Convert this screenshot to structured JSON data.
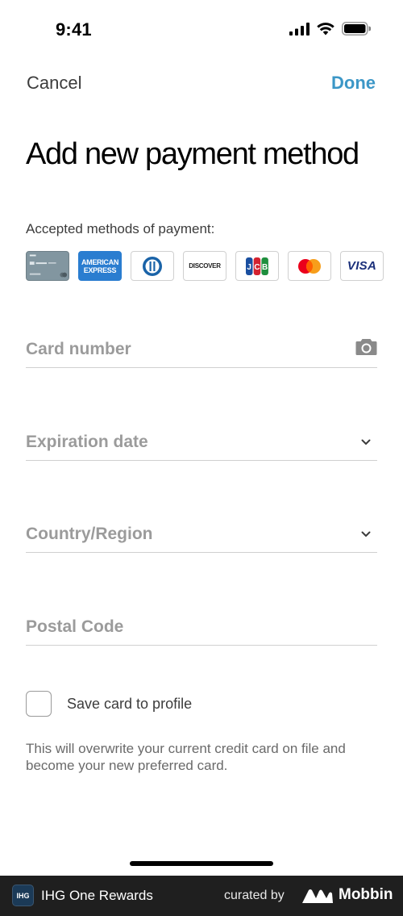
{
  "status_bar": {
    "time": "9:41"
  },
  "nav": {
    "cancel_label": "Cancel",
    "done_label": "Done"
  },
  "title": "Add new payment method",
  "accepted_label": "Accepted methods of payment:",
  "card_brands": [
    {
      "name": "IHG credit card"
    },
    {
      "name": "American Express",
      "text": "AMERICAN EXPRESS"
    },
    {
      "name": "Diners Club"
    },
    {
      "name": "Discover",
      "text": "DISCOVER"
    },
    {
      "name": "JCB"
    },
    {
      "name": "Mastercard"
    },
    {
      "name": "Visa",
      "text": "VISA"
    }
  ],
  "fields": {
    "card_number": {
      "label": "Card number",
      "icon": "camera-icon"
    },
    "expiration_date": {
      "label": "Expiration date",
      "icon": "chevron-down-icon"
    },
    "country_region": {
      "label": "Country/Region",
      "icon": "chevron-down-icon"
    },
    "postal_code": {
      "label": "Postal Code"
    }
  },
  "save_card": {
    "label": "Save card to profile",
    "checked": false
  },
  "note": "This will overwrite your current credit card on file and become your new preferred card.",
  "footer": {
    "app_logo_text": "IHG",
    "app_name": "IHG One Rewards",
    "curated_by": "curated by",
    "brand": "Mobbin"
  },
  "colors": {
    "accent": "#3c97c7",
    "placeholder": "#9b9b9b",
    "footer_bg": "#1f1f1f"
  }
}
